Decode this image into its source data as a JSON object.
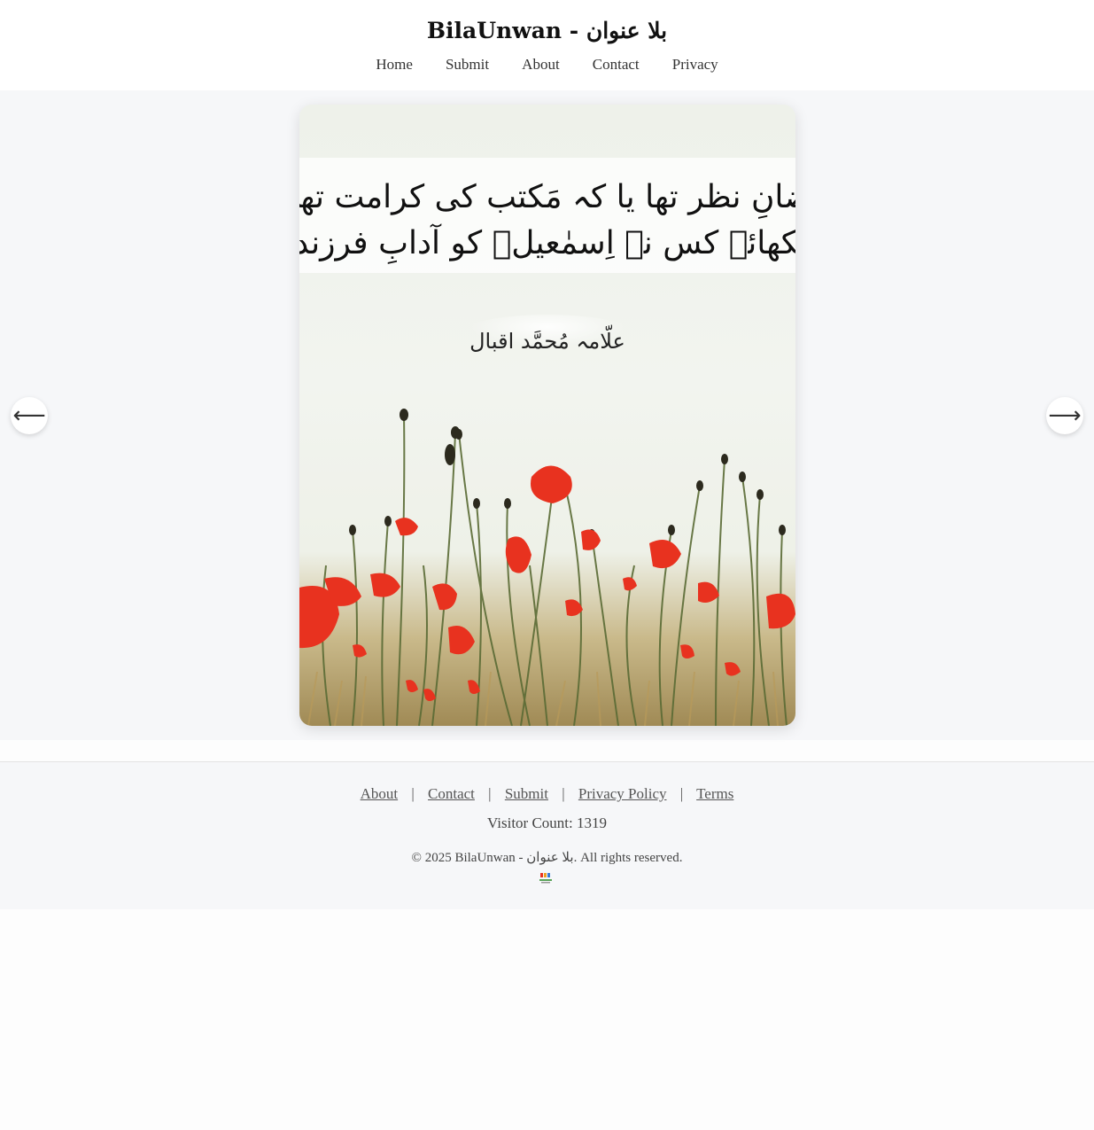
{
  "header": {
    "title": "BilaUnwan - بلا عنوان",
    "nav": [
      "Home",
      "Submit",
      "About",
      "Contact",
      "Privacy"
    ]
  },
  "slide": {
    "line1": "بضانِ نظر تھا یا کہ مَکتب کی کرامت تھی",
    "line2": "سکھائے کس نے اِسمٰعیلؑ کو آدابِ فرزندی",
    "poet": "علّامہ مُحمَّد اقبال",
    "prev_arrow": "⟵",
    "next_arrow": "⟶"
  },
  "footer": {
    "links": [
      "About",
      "Contact",
      "Submit",
      "Privacy Policy",
      "Terms"
    ],
    "separator": "|",
    "visitor_count": "Visitor Count: 1319",
    "copyright": "© 2025 BilaUnwan - بلا عنوان. All rights reserved."
  },
  "colors": {
    "flower": "#e8321f",
    "stem": "#5a6b35",
    "background": "#f6f7f9"
  }
}
